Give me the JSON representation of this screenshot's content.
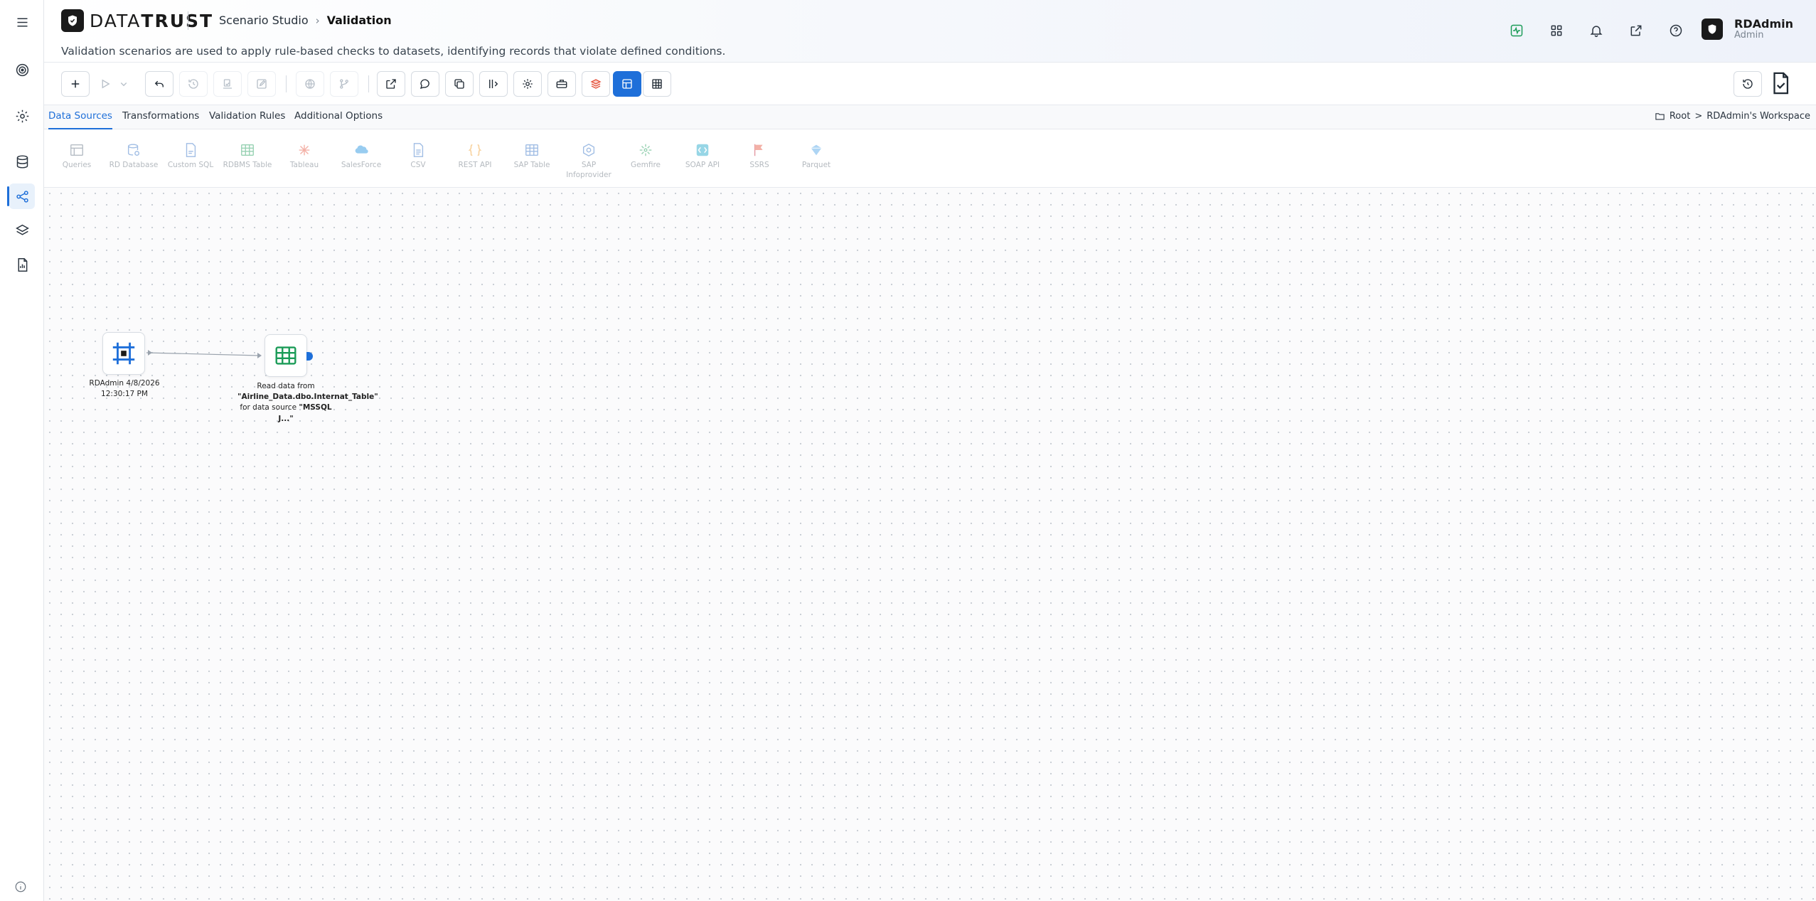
{
  "app": {
    "brand_light": "DATA",
    "brand_bold": "TRUST",
    "breadcrumb": [
      "Scenario Studio",
      "Validation"
    ],
    "description": "Validation scenarios are used to apply rule-based checks to datasets, identifying records that violate defined conditions."
  },
  "user": {
    "name": "RDAdmin",
    "role": "Admin"
  },
  "colors": {
    "accent": "#1e6fd9",
    "brand": "#1a1a1a",
    "success": "#1a9b57",
    "danger": "#e5533d"
  },
  "left_rail": {
    "items": [
      {
        "icon": "menu-icon"
      },
      {
        "icon": "target-icon"
      },
      {
        "icon": "settings-gear-icon"
      },
      {
        "icon": "database-icon"
      },
      {
        "icon": "scenario-flow-icon",
        "active": true
      },
      {
        "icon": "layers-icon"
      },
      {
        "icon": "report-document-icon"
      }
    ],
    "footer_icon": "info-icon"
  },
  "header_icons": [
    "activity-monitor-icon",
    "apps-grid-icon",
    "notification-bell-icon",
    "open-external-icon",
    "help-icon"
  ],
  "toolbar": {
    "buttons": [
      {
        "icon": "plus-icon",
        "enabled": true
      },
      {
        "icon": "play-icon",
        "enabled": false
      },
      {
        "icon": "chevron-down-icon",
        "enabled": false
      },
      {
        "icon": "undo-icon",
        "enabled": true
      },
      {
        "icon": "history-icon",
        "enabled": false
      },
      {
        "icon": "import-icon",
        "enabled": false
      },
      {
        "icon": "edit-icon",
        "enabled": false
      },
      {
        "icon": "globe-icon",
        "enabled": false
      },
      {
        "icon": "branch-icon",
        "enabled": false
      },
      {
        "icon": "export-icon",
        "enabled": true
      },
      {
        "icon": "comment-icon",
        "enabled": true
      },
      {
        "icon": "copy-icon",
        "enabled": true
      },
      {
        "icon": "column-settings-icon",
        "enabled": true
      },
      {
        "icon": "gear-icon",
        "enabled": true
      },
      {
        "icon": "toolbox-icon",
        "enabled": true
      },
      {
        "icon": "stack-icon",
        "enabled": true
      },
      {
        "icon": "canvas-view-icon",
        "enabled": true,
        "selected": true
      },
      {
        "icon": "table-view-icon",
        "enabled": true
      }
    ],
    "right_buttons": [
      {
        "icon": "restore-icon"
      },
      {
        "icon": "validate-document-icon"
      }
    ]
  },
  "tabs": [
    {
      "label": "Data Sources",
      "active": true
    },
    {
      "label": "Transformations",
      "active": false
    },
    {
      "label": "Validation Rules",
      "active": false
    },
    {
      "label": "Additional Options",
      "active": false
    }
  ],
  "workspace": {
    "root": "Root",
    "separator": ">",
    "name": "RDAdmin's Workspace"
  },
  "data_sources": [
    {
      "label": "Queries",
      "icon": "queries-icon"
    },
    {
      "label": "RD Database",
      "icon": "rd-database-icon"
    },
    {
      "label": "Custom SQL",
      "icon": "custom-sql-icon"
    },
    {
      "label": "RDBMS Table",
      "icon": "rdbms-table-icon"
    },
    {
      "label": "Tableau",
      "icon": "tableau-icon"
    },
    {
      "label": "SalesForce",
      "icon": "salesforce-icon"
    },
    {
      "label": "CSV",
      "icon": "csv-icon"
    },
    {
      "label": "REST API",
      "icon": "rest-api-icon"
    },
    {
      "label": "SAP Table",
      "icon": "sap-table-icon"
    },
    {
      "label": "SAP Infoprovider",
      "icon": "sap-infoprovider-icon"
    },
    {
      "label": "Gemfire",
      "icon": "gemfire-icon"
    },
    {
      "label": "SOAP API",
      "icon": "soap-api-icon"
    },
    {
      "label": "SSRS",
      "icon": "ssrs-icon"
    },
    {
      "label": "Parquet",
      "icon": "parquet-icon"
    }
  ],
  "canvas": {
    "nodes": [
      {
        "icon": "scenario-start-icon",
        "label": "RDAdmin 4/8/2026 12:30:17 PM"
      },
      {
        "icon": "table-source-icon",
        "label_prefix": "Read data from ",
        "label_bold1": "\"Airline_Data.dbo.Internat_Table\"",
        "label_mid": " for data source ",
        "label_bold2": "\"MSSQL J...\""
      }
    ]
  }
}
